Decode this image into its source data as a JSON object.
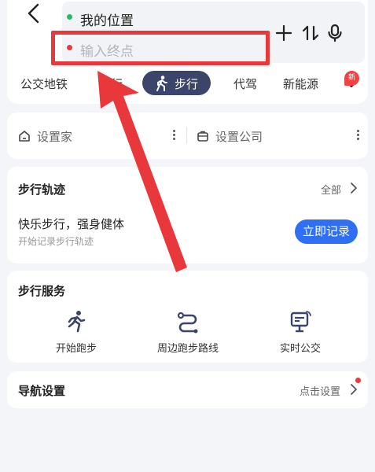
{
  "route": {
    "from_label": "我的位置",
    "to_placeholder": "输入终点"
  },
  "tabs": [
    {
      "label": "公交地铁"
    },
    {
      "label": "行"
    },
    {
      "label": "步行"
    },
    {
      "label": "代驾"
    },
    {
      "label": "新能源"
    }
  ],
  "tab_badge": "新",
  "shortcuts": {
    "home_label": "设置家",
    "company_label": "设置公司"
  },
  "track": {
    "title": "步行轨迹",
    "all_label": "全部",
    "slogan": "快乐步行，强身健体",
    "sub": "开始记录步行轨迹",
    "record_button": "立即记录"
  },
  "service": {
    "title": "步行服务",
    "items": [
      {
        "label": "开始跑步",
        "icon": "running-icon"
      },
      {
        "label": "周边跑步路线",
        "icon": "route-icon"
      },
      {
        "label": "实时公交",
        "icon": "bus-stop-icon"
      }
    ]
  },
  "nav": {
    "title": "导航设置",
    "link": "点击设置"
  },
  "colors": {
    "accent_blue": "#2e6ff5",
    "active_tab": "#3b4569",
    "highlight_red": "#e8383b",
    "start_dot": "#1fbf6a",
    "end_dot": "#e83a3a"
  }
}
